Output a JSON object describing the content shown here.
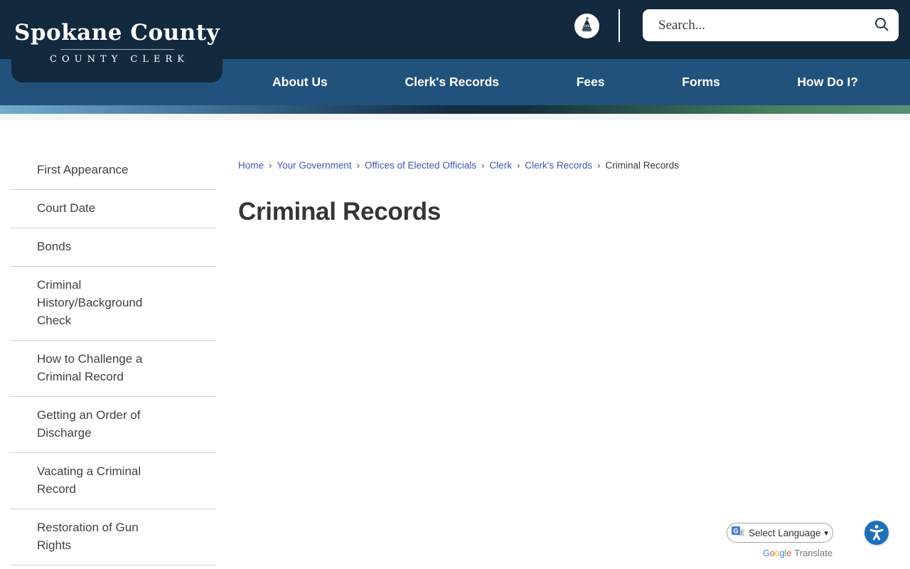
{
  "header": {
    "logo_title": "Spokane County",
    "logo_subtitle": "COUNTY CLERK",
    "search_placeholder": "Search..."
  },
  "nav": {
    "items": [
      {
        "label": "About Us"
      },
      {
        "label": "Clerk's Records"
      },
      {
        "label": "Fees"
      },
      {
        "label": "Forms"
      },
      {
        "label": "How Do I?"
      }
    ]
  },
  "breadcrumb": {
    "separator": "›",
    "links": [
      {
        "label": "Home"
      },
      {
        "label": "Your Government"
      },
      {
        "label": "Offices of Elected Officials"
      },
      {
        "label": "Clerk"
      },
      {
        "label": "Clerk's Records"
      }
    ],
    "current": "Criminal Records"
  },
  "page": {
    "title": "Criminal Records"
  },
  "sidebar": {
    "items": [
      {
        "label": "First Appearance"
      },
      {
        "label": "Court Date"
      },
      {
        "label": "Bonds"
      },
      {
        "label": "Criminal History/Background Check"
      },
      {
        "label": "How to Challenge a Criminal Record"
      },
      {
        "label": "Getting an Order of Discharge"
      },
      {
        "label": "Vacating a Criminal Record"
      },
      {
        "label": "Restoration of Gun Rights"
      }
    ]
  },
  "translate": {
    "select_label": "Select Language",
    "chevron": "▾",
    "brand_suffix": "Translate",
    "google_letters": [
      {
        "char": "G",
        "style": "color:#4285F4"
      },
      {
        "char": "o",
        "style": "color:#EA4335"
      },
      {
        "char": "o",
        "style": "color:#FBBC05"
      },
      {
        "char": "g",
        "style": "color:#4285F4"
      },
      {
        "char": "l",
        "style": "color:#34A853"
      },
      {
        "char": "e",
        "style": "color:#EA4335"
      }
    ]
  },
  "colors": {
    "header_navy": "#12293e",
    "nav_blue": "#21527b",
    "breadcrumb_link_blue": "#4356b0",
    "accessibility_blue": "#1d71b8",
    "strip_gradient_left": "#74abce",
    "strip_gradient_middle": "#122c42",
    "strip_gradient_right": "#579178"
  }
}
